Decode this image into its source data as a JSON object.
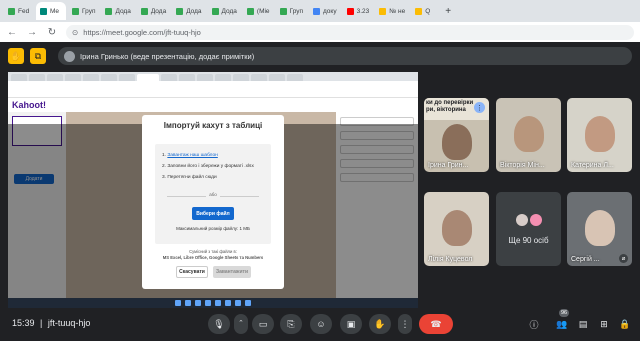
{
  "browser": {
    "tabs": [
      {
        "label": "Fed",
        "icon": "sheets-icon"
      },
      {
        "label": "Me",
        "icon": "meet-icon",
        "active": true
      },
      {
        "label": "Груп",
        "icon": "sheets-icon"
      },
      {
        "label": "Дода",
        "icon": "sheets-icon"
      },
      {
        "label": "Дода",
        "icon": "sheets-icon"
      },
      {
        "label": "Дода",
        "icon": "sheets-icon"
      },
      {
        "label": "Дода",
        "icon": "sheets-icon"
      },
      {
        "label": "(Міе",
        "icon": "sheets-icon"
      },
      {
        "label": "Груп",
        "icon": "sheets-icon"
      },
      {
        "label": "доку",
        "icon": "docs-icon"
      },
      {
        "label": "3.23",
        "icon": "yt-icon"
      },
      {
        "label": "№ не",
        "icon": "other-icon"
      },
      {
        "label": "Q",
        "icon": "other-icon"
      }
    ],
    "url": "https://meet.google.com/jft-tuuq-hjo"
  },
  "presenter_bar": {
    "text": "Ірина Гринько (веде презентацію, додає примітки)"
  },
  "shared_screen": {
    "app_logo": "Kahoot!",
    "add_button": "Додати",
    "modal": {
      "title": "Імпортуй кахут з таблиці",
      "step1_link": "Завантаж наш шаблон",
      "step1_prefix": "1. ",
      "step2": "2. Заповни його і збережи у форматі .xlsx",
      "step3": "3. Перетягни файл сюди",
      "or": "або",
      "choose_button": "Вибери файл",
      "max_size": "Максимальний розмір файлу: 1 МБ",
      "footer_line1": "Сумісний з такі файли в:",
      "footer_line2": "MS Excel, Libre Office, Google Sheets та Numbers",
      "cancel_button": "Скасувати",
      "download_button": "Завантажити"
    }
  },
  "participants": [
    {
      "name": "Ірина Грин...",
      "caption": "ки до перевірки\nри, вікторина",
      "has_menu": true
    },
    {
      "name": "Вікторія Мін...",
      "caption": ""
    },
    {
      "name": "Катерина Л...",
      "caption": ""
    },
    {
      "name": "Лілія Куцевол",
      "caption": ""
    },
    {
      "name": "Сергій ...",
      "caption": ""
    }
  ],
  "more_people": "Ще 90 осіб",
  "controls": {
    "time": "15:39",
    "meeting_code": "jft-tuuq-hjo",
    "participants_count": "96"
  }
}
